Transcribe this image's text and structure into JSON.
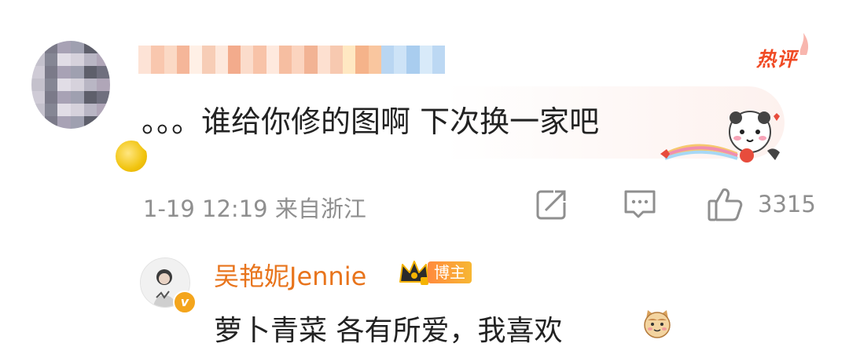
{
  "comment": {
    "hot_badge": "热评",
    "text": "。。。谁给你修的图啊 下次换一家吧",
    "meta": "1-19 12:19 来自浙江",
    "like_count": "3315"
  },
  "reply": {
    "author": "吴艳妮Jennie",
    "badge": "博主",
    "avatar_badge": "v",
    "text": "萝卜青菜 各有所爱，我喜欢"
  },
  "icons": {
    "share": "share-icon",
    "comment": "comment-icon",
    "like": "thumbs-up-icon",
    "crown": "crown-icon",
    "emoji": "cat-emoji-icon",
    "sticker": "panda-sticker-icon"
  },
  "colors": {
    "username": "#e8741c",
    "hot": "#f04a24",
    "meta": "#8f8f8f",
    "text": "#222222"
  }
}
